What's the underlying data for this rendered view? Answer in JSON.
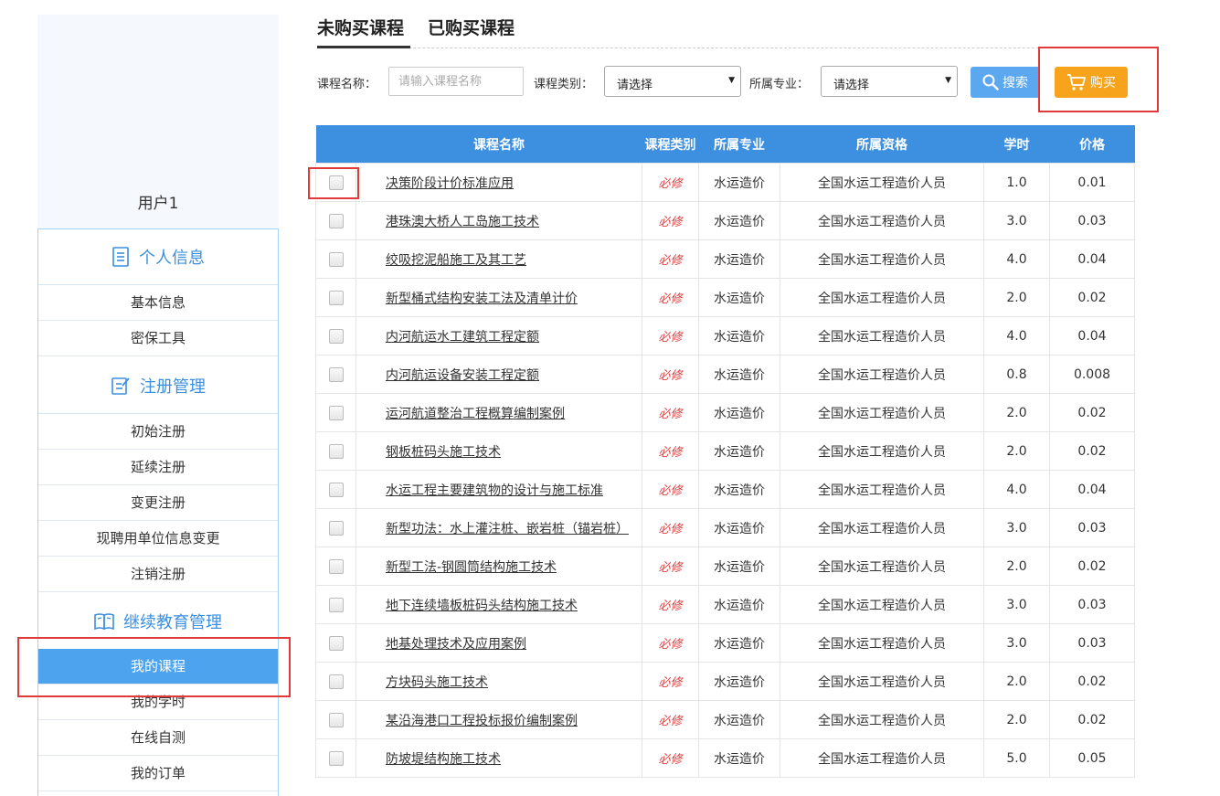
{
  "sidebar": {
    "username": "用户1",
    "sections": [
      {
        "label": "个人信息",
        "items": [
          "基本信息",
          "密保工具"
        ]
      },
      {
        "label": "注册管理",
        "items": [
          "初始注册",
          "延续注册",
          "变更注册",
          "现聘用单位信息变更",
          "注销注册"
        ]
      },
      {
        "label": "继续教育管理",
        "items": [
          "我的课程",
          "我的学时",
          "在线自测",
          "我的订单"
        ]
      }
    ]
  },
  "tabs": [
    "未购买课程",
    "已购买课程"
  ],
  "filters": {
    "name_label": "课程名称：",
    "name_placeholder": "请输入课程名称",
    "category_label": "课程类别：",
    "category_value": "请选择",
    "major_label": "所属专业：",
    "major_value": "请选择"
  },
  "buttons": {
    "search": "搜索",
    "buy": "购买"
  },
  "table": {
    "headers": [
      "",
      "课程名称",
      "课程类别",
      "所属专业",
      "所属资格",
      "学时",
      "价格"
    ],
    "rows": [
      [
        "决策阶段计价标准应用",
        "必修",
        "水运造价",
        "全国水运工程造价人员",
        "1.0",
        "0.01"
      ],
      [
        "港珠澳大桥人工岛施工技术",
        "必修",
        "水运造价",
        "全国水运工程造价人员",
        "3.0",
        "0.03"
      ],
      [
        "绞吸挖泥船施工及其工艺",
        "必修",
        "水运造价",
        "全国水运工程造价人员",
        "4.0",
        "0.04"
      ],
      [
        "新型桶式结构安装工法及清单计价",
        "必修",
        "水运造价",
        "全国水运工程造价人员",
        "2.0",
        "0.02"
      ],
      [
        "内河航运水工建筑工程定额",
        "必修",
        "水运造价",
        "全国水运工程造价人员",
        "4.0",
        "0.04"
      ],
      [
        "内河航运设备安装工程定额",
        "必修",
        "水运造价",
        "全国水运工程造价人员",
        "0.8",
        "0.008"
      ],
      [
        "运河航道整治工程概算编制案例",
        "必修",
        "水运造价",
        "全国水运工程造价人员",
        "2.0",
        "0.02"
      ],
      [
        "钢板桩码头施工技术",
        "必修",
        "水运造价",
        "全国水运工程造价人员",
        "2.0",
        "0.02"
      ],
      [
        "水运工程主要建筑物的设计与施工标准",
        "必修",
        "水运造价",
        "全国水运工程造价人员",
        "4.0",
        "0.04"
      ],
      [
        "新型功法：水上灌注桩、嵌岩桩（锚岩桩）",
        "必修",
        "水运造价",
        "全国水运工程造价人员",
        "3.0",
        "0.03"
      ],
      [
        "新型工法-钢圆筒结构施工技术",
        "必修",
        "水运造价",
        "全国水运工程造价人员",
        "2.0",
        "0.02"
      ],
      [
        "地下连续墙板桩码头结构施工技术",
        "必修",
        "水运造价",
        "全国水运工程造价人员",
        "3.0",
        "0.03"
      ],
      [
        "地基处理技术及应用案例",
        "必修",
        "水运造价",
        "全国水运工程造价人员",
        "3.0",
        "0.03"
      ],
      [
        "方块码头施工技术",
        "必修",
        "水运造价",
        "全国水运工程造价人员",
        "2.0",
        "0.02"
      ],
      [
        "某沿海港口工程投标报价编制案例",
        "必修",
        "水运造价",
        "全国水运工程造价人员",
        "2.0",
        "0.02"
      ],
      [
        "防坡堤结构施工技术",
        "必修",
        "水运造价",
        "全国水运工程造价人员",
        "5.0",
        "0.05"
      ]
    ]
  },
  "colors": {
    "accent": "#3d8fe0",
    "buy": "#f8a31c",
    "required": "#e23c3c",
    "highlight": "#e03a3a"
  }
}
